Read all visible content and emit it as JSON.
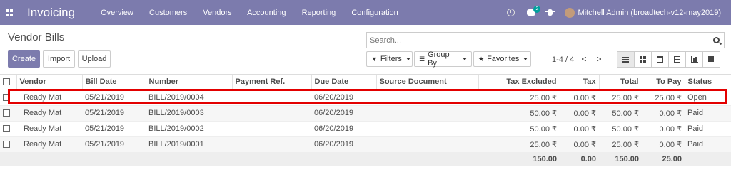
{
  "navbar": {
    "app_title": "Invoicing",
    "menu": [
      "Overview",
      "Customers",
      "Vendors",
      "Accounting",
      "Reporting",
      "Configuration"
    ],
    "chat_badge": "2",
    "user": "Mitchell Admin (broadtech-v12-may2019)",
    "bg_color": "#7c7bad"
  },
  "control": {
    "breadcrumb": "Vendor Bills",
    "search_placeholder": "Search...",
    "create_label": "Create",
    "import_label": "Import",
    "upload_label": "Upload",
    "filters_label": "Filters",
    "groupby_label": "Group By",
    "favorites_label": "Favorites",
    "pager": "1-4 / 4",
    "pager_prev": "<",
    "pager_next": ">",
    "views": [
      "list-view-icon",
      "kanban-view-icon",
      "calendar-view-icon",
      "pivot-view-icon",
      "graph-view-icon",
      "grid-view-icon"
    ]
  },
  "table": {
    "headers": [
      "Vendor",
      "Bill Date",
      "Number",
      "Payment Ref.",
      "Due Date",
      "Source Document",
      "Tax Excluded",
      "Tax",
      "Total",
      "To Pay",
      "Status"
    ],
    "rows": [
      [
        "Ready Mat",
        "05/21/2019",
        "BILL/2019/0004",
        "",
        "06/20/2019",
        "",
        "25.00 ₹",
        "0.00 ₹",
        "25.00 ₹",
        "25.00 ₹",
        "Open"
      ],
      [
        "Ready Mat",
        "05/21/2019",
        "BILL/2019/0003",
        "",
        "06/20/2019",
        "",
        "50.00 ₹",
        "0.00 ₹",
        "50.00 ₹",
        "0.00 ₹",
        "Paid"
      ],
      [
        "Ready Mat",
        "05/21/2019",
        "BILL/2019/0002",
        "",
        "06/20/2019",
        "",
        "50.00 ₹",
        "0.00 ₹",
        "50.00 ₹",
        "0.00 ₹",
        "Paid"
      ],
      [
        "Ready Mat",
        "05/21/2019",
        "BILL/2019/0001",
        "",
        "06/20/2019",
        "",
        "25.00 ₹",
        "0.00 ₹",
        "25.00 ₹",
        "0.00 ₹",
        "Paid"
      ]
    ],
    "totals": {
      "tax_excluded": "150.00",
      "tax": "0.00",
      "total": "150.00",
      "to_pay": "25.00"
    },
    "highlight_color": "#e30000"
  }
}
